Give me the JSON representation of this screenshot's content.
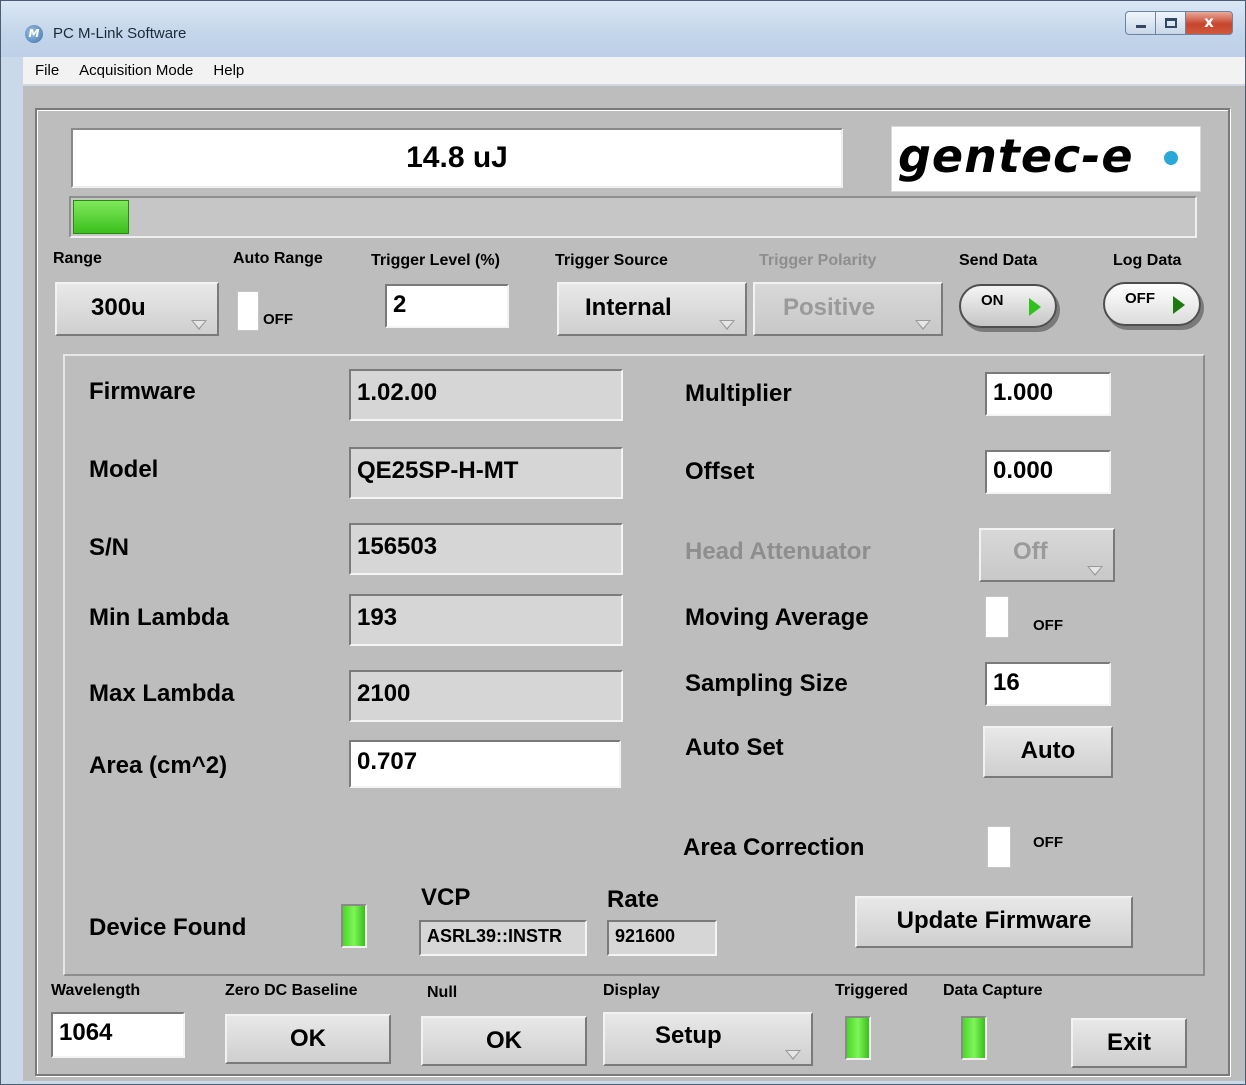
{
  "window": {
    "title": "PC M-Link Software",
    "app_icon_letter": "M"
  },
  "menu": [
    "File",
    "Acquisition Mode",
    "Help"
  ],
  "readout": {
    "value": "14.8 uJ",
    "bar_level_fraction": 0.05
  },
  "logo": {
    "text": "gentec-e"
  },
  "top_controls": {
    "range": {
      "label": "Range",
      "value": "300u"
    },
    "auto_range": {
      "label": "Auto Range",
      "state": "OFF"
    },
    "trigger_level": {
      "label": "Trigger Level (%)",
      "value": "2"
    },
    "trigger_source": {
      "label": "Trigger Source",
      "value": "Internal"
    },
    "trigger_polarity": {
      "label": "Trigger Polarity",
      "value": "Positive"
    },
    "send_data": {
      "label": "Send Data",
      "state": "ON"
    },
    "log_data": {
      "label": "Log Data",
      "state": "OFF"
    }
  },
  "info": {
    "firmware": {
      "label": "Firmware",
      "value": "1.02.00"
    },
    "model": {
      "label": "Model",
      "value": "QE25SP-H-MT"
    },
    "sn": {
      "label": "S/N",
      "value": "156503"
    },
    "min_lambda": {
      "label": "Min Lambda",
      "value": "193"
    },
    "max_lambda": {
      "label": "Max Lambda",
      "value": "2100"
    },
    "area": {
      "label": "Area (cm^2)",
      "value": "0.707"
    }
  },
  "settings": {
    "multiplier": {
      "label": "Multiplier",
      "value": "1.000"
    },
    "offset": {
      "label": "Offset",
      "value": "0.000"
    },
    "head_attenuator": {
      "label": "Head Attenuator",
      "value": "Off"
    },
    "moving_average": {
      "label": "Moving Average",
      "state": "OFF"
    },
    "sampling_size": {
      "label": "Sampling Size",
      "value": "16"
    },
    "auto_set": {
      "label": "Auto Set",
      "button": "Auto"
    },
    "area_correction": {
      "label": "Area Correction",
      "state": "OFF"
    }
  },
  "device": {
    "found_label": "Device Found",
    "vcp": {
      "label": "VCP",
      "value": "ASRL39::INSTR"
    },
    "rate": {
      "label": "Rate",
      "value": "921600"
    },
    "update_firmware": "Update Firmware"
  },
  "bottom": {
    "wavelength": {
      "label": "Wavelength",
      "value": "1064"
    },
    "zero_dc": {
      "label": "Zero DC Baseline",
      "button": "OK"
    },
    "null": {
      "label": "Null",
      "button": "OK"
    },
    "display": {
      "label": "Display",
      "value": "Setup"
    },
    "triggered": {
      "label": "Triggered"
    },
    "data_capture": {
      "label": "Data Capture"
    },
    "exit": "Exit"
  },
  "colors": {
    "led_green": "#4ad826",
    "panel_gray": "#bdbdbd",
    "title_blue": "#c9d9ea"
  }
}
